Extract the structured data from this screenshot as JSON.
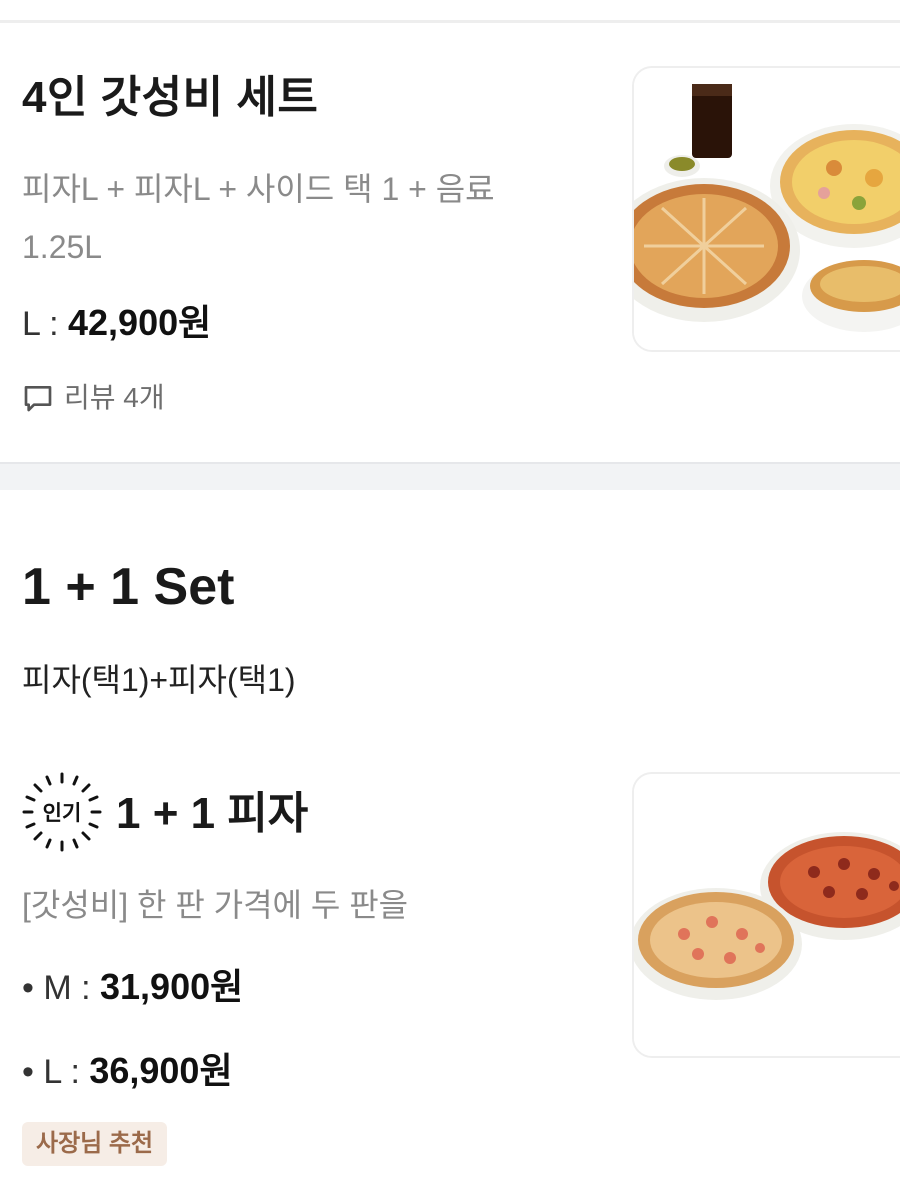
{
  "set_card": {
    "title": "4인 갓성비 세트",
    "description": "피자L + 피자L + 사이드 택 1 + 음료 1.25L",
    "price_label": "L : ",
    "price_value": "42,900원",
    "review_text": "리뷰 4개",
    "review_icon": "chat-bubble-icon",
    "image_alt": "pizza-set-photo"
  },
  "section": {
    "title": "1 + 1 Set",
    "description": "피자(택1)+피자(택1)"
  },
  "menu_item": {
    "badge": "인기",
    "title": "1 + 1 피자",
    "description": "[갓성비] 한 판 가격에 두 판을",
    "prices": [
      {
        "label": "• M : ",
        "value": "31,900원"
      },
      {
        "label": "• L : ",
        "value": "36,900원"
      }
    ],
    "tag": "사장님 추천",
    "image_alt": "two-pizzas-photo"
  },
  "colors": {
    "tag_bg": "#f6ede6",
    "tag_text": "#9b6a4a",
    "muted_text": "#8a8a8a",
    "divider": "#f2f3f5"
  }
}
